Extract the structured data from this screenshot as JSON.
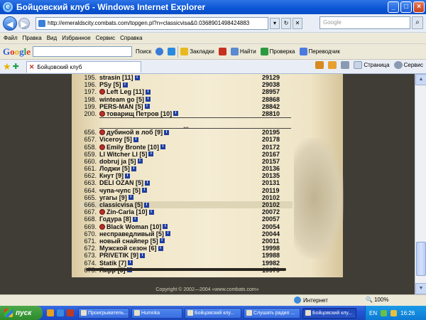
{
  "window": {
    "title": "Бойцовский клуб - Windows Internet Explorer"
  },
  "address": {
    "url": "http://emeraldscity.combats.com/topgen.pl?n=classicvisa&0.0368901498424883",
    "search_placeholder": "Google"
  },
  "menu": [
    "Файл",
    "Правка",
    "Вид",
    "Избранное",
    "Сервис",
    "Справка"
  ],
  "googlebar": {
    "brand": [
      "G",
      "o",
      "o",
      "g",
      "l",
      "e"
    ],
    "search_label": "Поиск",
    "bookmarks": "Закладки",
    "find": "Найти",
    "check": "Проверка",
    "translate": "Переводчик"
  },
  "tab": {
    "label": "Бойцовский клуб"
  },
  "toolbar": {
    "page": "Страница",
    "tools": "Сервис"
  },
  "ranking_top": [
    {
      "rank": "195.",
      "name": "strasin [11]",
      "score": "29129",
      "clan": false
    },
    {
      "rank": "196.",
      "name": "PSy [5]",
      "score": "29038",
      "clan": false
    },
    {
      "rank": "197.",
      "name": "Left Leg [11]",
      "score": "28957",
      "clan": true
    },
    {
      "rank": "198.",
      "name": "winteam go [5]",
      "score": "28868",
      "clan": false
    },
    {
      "rank": "199.",
      "name": "PERS-MAN [5]",
      "score": "28842",
      "clan": false
    },
    {
      "rank": "200.",
      "name": "товарищ Петров [10]",
      "score": "28810",
      "clan": true
    }
  ],
  "ellipsis": "...",
  "ranking_bottom": [
    {
      "rank": "656.",
      "name": "дубиной в лоб [9]",
      "score": "20195",
      "clan": true
    },
    {
      "rank": "657.",
      "name": "Viceroy [5]",
      "score": "20178",
      "clan": false
    },
    {
      "rank": "658.",
      "name": "Emily Bronte [10]",
      "score": "20172",
      "clan": true
    },
    {
      "rank": "659.",
      "name": "LI Witcher LI [5]",
      "score": "20167",
      "clan": false
    },
    {
      "rank": "660.",
      "name": "dobruj ja [5]",
      "score": "20157",
      "clan": false
    },
    {
      "rank": "661.",
      "name": "Лоджи [5]",
      "score": "20136",
      "clan": false
    },
    {
      "rank": "662.",
      "name": "Кнут [9]",
      "score": "20135",
      "clan": false
    },
    {
      "rank": "663.",
      "name": "DELI OZAN [5]",
      "score": "20131",
      "clan": false
    },
    {
      "rank": "664.",
      "name": "чупа-чупс [5]",
      "score": "20119",
      "clan": false
    },
    {
      "rank": "665.",
      "name": "угагы [9]",
      "score": "20102",
      "clan": false
    },
    {
      "rank": "666.",
      "name": "classicvisa [5]",
      "score": "20102",
      "clan": false,
      "highlight": true
    },
    {
      "rank": "667.",
      "name": "Zin-Carla [10]",
      "score": "20072",
      "clan": true
    },
    {
      "rank": "668.",
      "name": "Годура [8]",
      "score": "20057",
      "clan": false
    },
    {
      "rank": "669.",
      "name": "Black Woman [10]",
      "score": "20054",
      "clan": true
    },
    {
      "rank": "670.",
      "name": "несправедливый [5]",
      "score": "20044",
      "clan": false
    },
    {
      "rank": "671.",
      "name": "новый снайпер [5]",
      "score": "20011",
      "clan": false
    },
    {
      "rank": "672.",
      "name": "Мужской сезон [6]",
      "score": "19998",
      "clan": false
    },
    {
      "rank": "673.",
      "name": "PRIVETIK [9]",
      "score": "19988",
      "clan": false
    },
    {
      "rank": "674.",
      "name": "Statik [7]",
      "score": "19982",
      "clan": false
    },
    {
      "rank": "675.",
      "name": "Пирр [5]",
      "score": "19979",
      "clan": false
    }
  ],
  "info_glyph": "i",
  "footer": {
    "copyright": "Copyright © 2002—2004 «www.combats.com»"
  },
  "status": {
    "zone": "Интернет",
    "zoom": "100%"
  },
  "taskbar": {
    "start": "пуск",
    "buttons": [
      {
        "label": "Проигрыватель..."
      },
      {
        "label": "Humnka"
      },
      {
        "label": "Бойцовский клу..."
      },
      {
        "label": "Слушать радио ..."
      },
      {
        "label": "Бойцовский клу...",
        "active": true
      }
    ],
    "lang": "EN",
    "clock": "16:26"
  },
  "colors": {
    "parchment": "#f4ecd3",
    "frame": "#3f3d36",
    "highlight_row": "#ded4b6",
    "title_blue": "#0a54d4"
  }
}
